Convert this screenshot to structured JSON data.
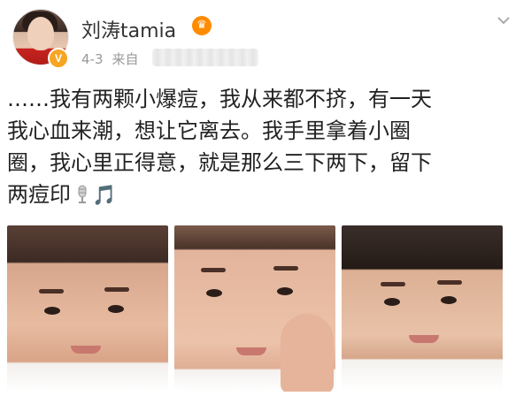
{
  "post": {
    "author": {
      "name": "刘涛tamia",
      "verified_badge": "V",
      "crown_badge": "crown-icon"
    },
    "meta": {
      "date": "4-3",
      "source_prefix": "来自"
    },
    "text_lines": [
      "……我有两颗小爆痘，我从来都不挤，有一天",
      "我心血来潮，想让它离去。我手里拿着小圈",
      "圈，我心里正得意，就是那么三下两下，留下",
      "两痘印"
    ],
    "emoji": {
      "mic": "microphone-icon",
      "music": "🎵"
    },
    "photos": [
      {
        "name": "selfie-photo-1"
      },
      {
        "name": "selfie-photo-2"
      },
      {
        "name": "selfie-photo-3"
      }
    ]
  },
  "colors": {
    "badge": "#f5a623",
    "meta": "#999999",
    "text": "#222222"
  }
}
